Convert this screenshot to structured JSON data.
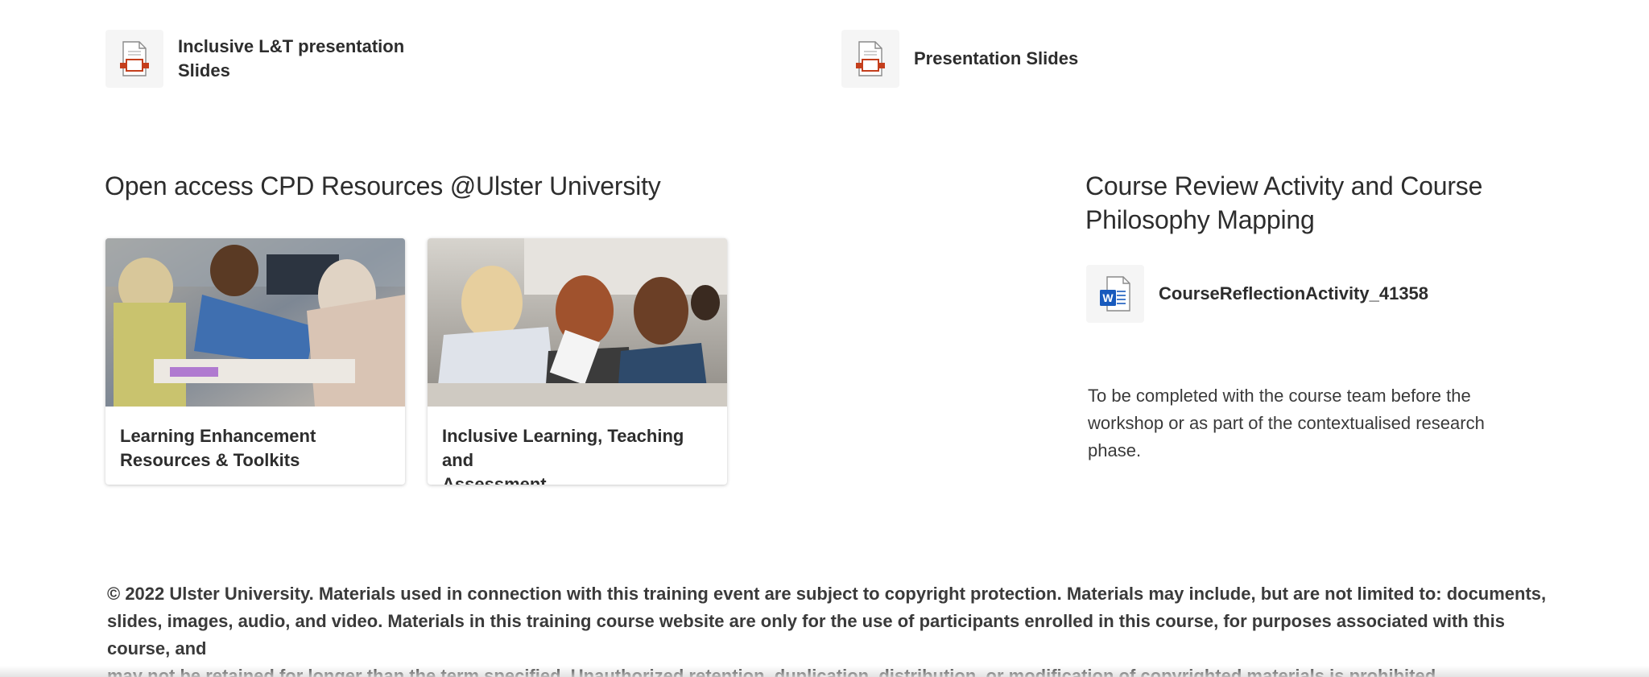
{
  "files": {
    "inclusive_slides": {
      "label_line1": "Inclusive L&T presentation",
      "label_line2": "Slides",
      "icon": "presentation-file-icon"
    },
    "presentation_slides": {
      "label": "Presentation Slides",
      "icon": "presentation-file-icon"
    },
    "course_reflection": {
      "label": "CourseReflectionActivity_41358",
      "icon": "word-document-icon"
    }
  },
  "cpd_section": {
    "title": "Open access CPD Resources @Ulster University",
    "cards": [
      {
        "title_line1": "Learning Enhancement",
        "title_line2": "Resources & Toolkits"
      },
      {
        "title_line1": "Inclusive Learning, Teaching and",
        "title_line2": "Assessment"
      }
    ]
  },
  "review_section": {
    "title_line1": "Course Review Activity and Course",
    "title_line2": "Philosophy Mapping",
    "note_line1": "To be completed with the course team before the",
    "note_line2": "workshop or as part of the contextualised research phase."
  },
  "footer": {
    "line1": "© 2022 Ulster University. Materials used in connection with this training event are subject to copyright protection.  Materials may include, but are not limited to: documents,",
    "line2": "slides, images, audio, and video.  Materials in this training course website are only for the use of participants enrolled in this course, for purposes associated with this course, and",
    "line3": "may not be retained for longer than the term specified. Unauthorized retention, duplication, distribution, or modification of copyrighted materials is prohibited."
  },
  "colors": {
    "ppt_red": "#c43e1c",
    "word_blue": "#185abd"
  }
}
